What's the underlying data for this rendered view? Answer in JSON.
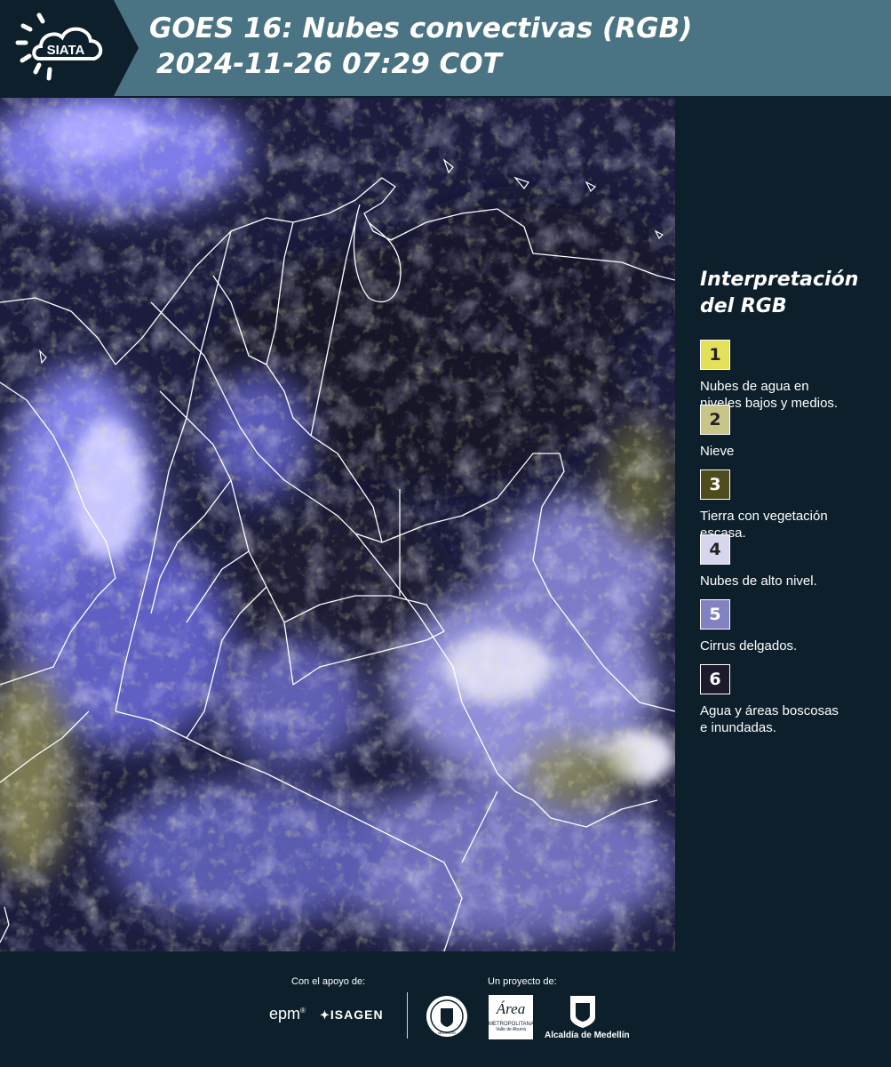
{
  "header": {
    "logo_text": "SIATA",
    "title_line1": "GOES 16: Nubes convectivas (RGB)",
    "title_line2": "2024-11-26 07:29 COT"
  },
  "legend": {
    "title_line1": "Interpretación",
    "title_line2": "del RGB",
    "items": [
      {
        "num": "1",
        "color": "#e3e05c",
        "label_line1": "Nubes de agua en",
        "label_line2": "niveles bajos y medios."
      },
      {
        "num": "2",
        "color": "#c8c58a",
        "label_line1": "Nieve",
        "label_line2": ""
      },
      {
        "num": "3",
        "color": "#4e4c1c",
        "label_line1": "Tierra con vegetación",
        "label_line2": "escasa."
      },
      {
        "num": "4",
        "color": "#d8d6ef",
        "label_line1": "Nubes de alto nivel.",
        "label_line2": ""
      },
      {
        "num": "5",
        "color": "#8282c3",
        "label_line1": "Cirrus delgados.",
        "label_line2": ""
      },
      {
        "num": "6",
        "color": "#1e1a2e",
        "label_line1": "Agua y áreas boscosas",
        "label_line2": "e inundadas."
      }
    ]
  },
  "footer": {
    "support_label": "Con el apoyo de:",
    "project_label": "Un proyecto de:",
    "logos": {
      "epm": "epm",
      "isagen": "ISAGEN",
      "area_line1": "Área",
      "area_line2": "METROPOLITANA",
      "area_line3": "Valle de Aburrá",
      "alcaldia": "Alcaldía de Medellín",
      "seal": "MEDELLÍN"
    }
  }
}
